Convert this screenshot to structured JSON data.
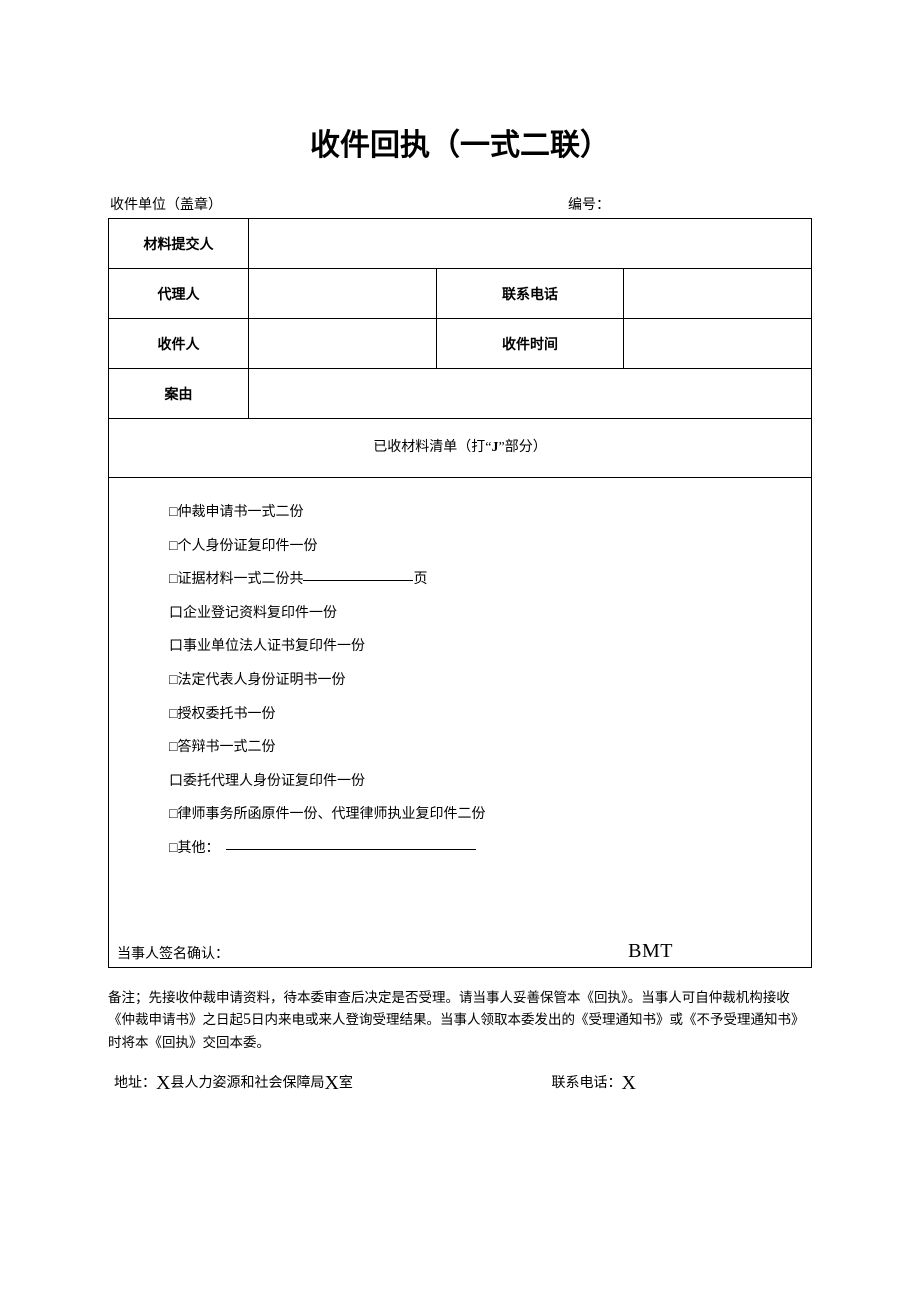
{
  "title": "收件回执（一式二联）",
  "header": {
    "left": "收件单位（盖章）",
    "right": "编号：",
    "right_value": ""
  },
  "rows": {
    "submitter_label": "材料提交人",
    "submitter_value": "",
    "agent_label": "代理人",
    "agent_value": "",
    "phone_label": "联系电话",
    "phone_value": "",
    "receiver_label": "收件人",
    "receiver_value": "",
    "receive_time_label": "收件时间",
    "receive_time_value": "",
    "cause_label": "案由",
    "cause_value": ""
  },
  "section_head_prefix": "已收材料清单（打“",
  "section_head_J": "J",
  "section_head_suffix": "”部分）",
  "checklist": [
    "□仲裁申请书一式二份",
    "□个人身份证复印件一份",
    "□证据材料一式二份共",
    "页",
    "口企业登记资料复印件一份",
    "口事业单位法人证书复印件一份",
    "□法定代表人身份证明书一份",
    "□授权委托书一份",
    "□答辩书一式二份",
    "口委托代理人身份证复印件一份",
    "□律师事务所函原件一份、代理律师执业复印件二份",
    "□其他："
  ],
  "evidence_pages": "",
  "other_text": "",
  "signature_label": "当事人签名确认：",
  "bmt": "BMT",
  "remark_prefix": "备注；先接收仲裁申请资料，待本委审查后决定是否受理。请当事人妥善保管本《回执》。当事人可自仲裁机构接收《仲裁申请书》之日起",
  "remark_five": "5",
  "remark_suffix": "日内来电或来人登询受理结果。当事人领取本委发出的《受理通知书》或《不予受理通知书》时将本《回执》交回本委。",
  "address": {
    "label": "地址：",
    "x1": "X",
    "mid1": "县人力姿源和社会保障局",
    "x2": "X",
    "mid2": "室",
    "phone_label": "联系电话：",
    "phone_x": "X"
  }
}
